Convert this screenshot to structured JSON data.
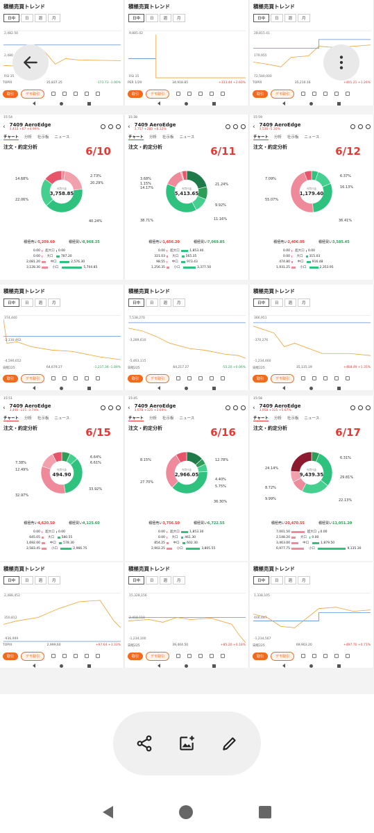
{
  "trend_common": {
    "title": "積極売買トレンド",
    "tabs": [
      "日中",
      "日",
      "週",
      "月"
    ],
    "buy": "取引",
    "demo": "デモ取引"
  },
  "trend_row1": [
    {
      "ytop": "2,482.50",
      "ymid": "2,480",
      "ybot": "RSI 35",
      "stat_l": "TOPIX",
      "stat_m": "35,837.25",
      "stat_r": "-173.73 -1.00%"
    },
    {
      "ytop": "9,885.02",
      "ymid": "",
      "ybot": "RSI 35",
      "stat_l": "PER 1/29",
      "stat_m": "34,918.85",
      "stat_r": "+333.44 +2.60%"
    },
    {
      "ytop": "28,815.41",
      "ymid": "179,955",
      "ybot": "72,500,000",
      "stat_l": "TOPIX",
      "stat_m": "35,210.16",
      "stat_r": "+401.21 +1.26%"
    }
  ],
  "trend_row2": [
    {
      "ytop": "374,440",
      "ymid": "-2,130,462",
      "ybot": "-4,590,652",
      "stat_l": "日経225",
      "stat_m": "64,679.27",
      "stat_r": "-1,237.36 -1.89%"
    },
    {
      "ytop": "7,538,270",
      "ymid": "-3,289,610",
      "ybot": "-5,463,115",
      "stat_l": "日経225",
      "stat_m": "64,217.27",
      "stat_r": "-55.20 +0.06%"
    },
    {
      "ytop": "366,951",
      "ymid": "-370,276",
      "ybot": "-1,234,460",
      "stat_l": "日経225",
      "stat_m": "35,115.19",
      "stat_r": "+468.49 +1.35%"
    }
  ],
  "trend_row3": [
    {
      "ytop": "2,488,452",
      "ymid": "350,812",
      "ybot": "-936,999",
      "stat_l": "TOPIX",
      "stat_m": "2,999.60",
      "stat_r": "+97.64 +3.33%"
    },
    {
      "ytop": "15,328,156",
      "ymid": "2,418,110",
      "ybot": "-1,234,100",
      "stat_l": "日経225",
      "stat_m": "39,404.50",
      "stat_r": "+85.20 +0.18%"
    },
    {
      "ytop": "1,338,105",
      "ymid": "406,447",
      "ybot": "-1,234,567",
      "stat_l": "日経225",
      "stat_m": "69,903.20",
      "stat_r": "+497.70 +0.71%"
    }
  ],
  "stock_common": {
    "code": "7409",
    "name": "AeroEdge",
    "tabs": [
      "チャート",
      "分析",
      "社示板",
      "ニュース"
    ],
    "title": "注文・約定分析",
    "center_label": "売買代金",
    "sell_label": "積極売い",
    "buy_label": "積極買い",
    "size_labels": [
      "超大口",
      "大口",
      "中口",
      "小口"
    ]
  },
  "stocks": [
    {
      "date": "6/10",
      "time": "15:54",
      "sub": "3,433 +67 +4.99%",
      "center": "3,758.85",
      "pcts": [
        "2.73%",
        "20.29%",
        "40.24%",
        "22.06%",
        "14.68%"
      ],
      "sell": "5,209.60",
      "buy": "8,968.35",
      "rows": [
        [
          "0.00",
          "0.00"
        ],
        [
          "0.00",
          "787.20"
        ],
        [
          "2,081.20",
          "2,576.30"
        ],
        [
          "3,128.30",
          "5,704.85"
        ]
      ]
    },
    {
      "date": "6/11",
      "time": "15:38",
      "sub": "3,757 +280 +8.32%",
      "center": "5,413.65",
      "pcts": [
        "21.24%",
        "9.92%",
        "11.16%",
        "38.71%",
        "14.17%",
        "1.15%",
        "3.68%"
      ],
      "sell": "1,656.20",
      "buy": "7,069.85",
      "rows": [
        [
          "0.00",
          "1,853.40"
        ],
        [
          "321.03",
          "565.35"
        ],
        [
          "98.55",
          "973.43"
        ],
        [
          "1,256.35",
          "3,377.50"
        ]
      ]
    },
    {
      "date": "6/12",
      "time": "15:59",
      "sub": "3,530 -5.30%",
      "center": "1,179.40",
      "pcts": [
        "6.37%",
        "16.13%",
        "36.41%",
        "55.07%",
        "7.09%"
      ],
      "sell": "2,406.05",
      "buy": "3,585.45",
      "rows": [
        [
          "0.00",
          "0.00"
        ],
        [
          "0.00",
          "315.03"
        ],
        [
          "474.80",
          "916.48"
        ],
        [
          "1,931.25",
          "2,353.95"
        ]
      ]
    },
    {
      "date": "6/15",
      "time": "15:51",
      "sub": "3,490 -115 -3.74%",
      "center": "494.90",
      "pcts": [
        "6.64%",
        "6.61%",
        "33.92%",
        "32.97%",
        "12.49%",
        "7.38%"
      ],
      "sell": "4,620.50",
      "buy": "4,125.60",
      "rows": [
        [
          "0.00",
          "0.00"
        ],
        [
          "645.05",
          "580.55"
        ],
        [
          "1,692.00",
          "578.30"
        ],
        [
          "2,583.45",
          "2,966.75"
        ]
      ]
    },
    {
      "date": "6/16",
      "time": "15:45",
      "sub": "3,678 +125 +3.69%",
      "center": "2,966.05",
      "pcts": [
        "12.78%",
        "4.40%",
        "5.75%",
        "36.30%",
        "27.70%",
        "8.15%"
      ],
      "sell": "3,756.50",
      "buy": "6,722.55",
      "rows": [
        [
          "0.00",
          "1,853.30"
        ],
        [
          "0.00",
          "461.30"
        ],
        [
          "854.25",
          "602.30"
        ],
        [
          "2,902.25",
          "3,805.55"
        ]
      ]
    },
    {
      "date": "6/17",
      "time": "15:58",
      "sub": "3,958 +315 +5.67%",
      "center": "9,439.35",
      "pcts": [
        "6.31%",
        "29.81%",
        "22.13%",
        "9.99%",
        "8.72%",
        "24.14%"
      ],
      "sell": "20,470.55",
      "buy": "11,051.20",
      "rows": [
        [
          "7,001.50",
          "0.00"
        ],
        [
          "2,148.20",
          "0.00"
        ],
        [
          "3,463.00",
          "1,879.50"
        ],
        [
          "6,977.75",
          "9,135.30"
        ]
      ]
    }
  ],
  "actions": {
    "share": "share-icon",
    "add_image": "add-image-icon",
    "edit": "edit-icon"
  }
}
